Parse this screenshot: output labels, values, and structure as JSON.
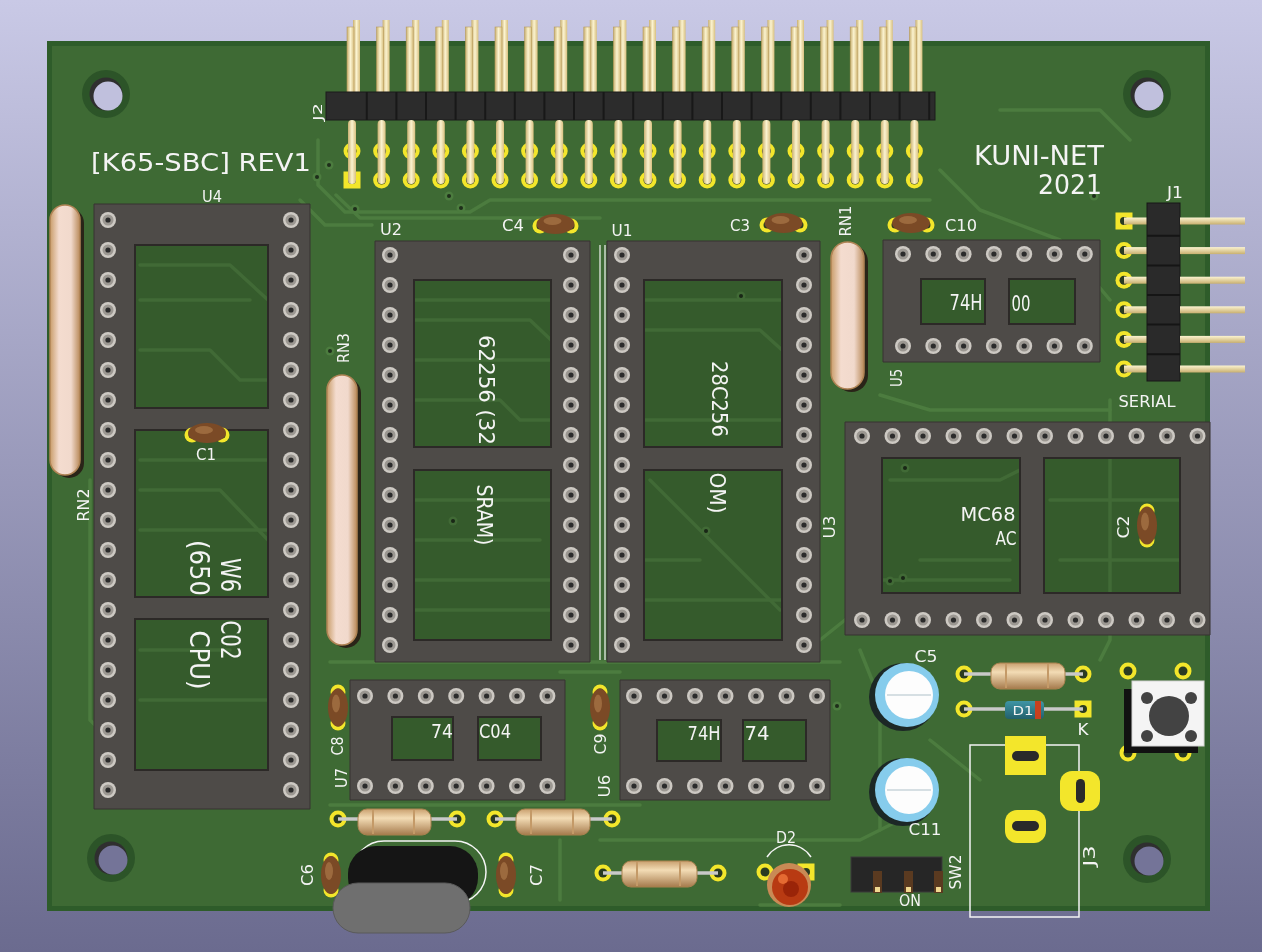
{
  "board": {
    "title": "[K65-SBC] REV1",
    "maker": "KUNI-NET",
    "year": "2021"
  },
  "components": [
    {
      "kind": "pin_header",
      "ref": "J2"
    },
    {
      "kind": "dip_socket",
      "ref": "U4",
      "marking": [
        "W6",
        "C02",
        "(650",
        "CPU)"
      ]
    },
    {
      "kind": "resistor_network",
      "ref": "RN2"
    },
    {
      "kind": "ceramic_capacitor",
      "ref": "C1"
    },
    {
      "kind": "resistor_network",
      "ref": "RN3"
    },
    {
      "kind": "dip_socket",
      "ref": "U2",
      "marking": [
        "62256 (32",
        "SRAM)"
      ]
    },
    {
      "kind": "ceramic_capacitor",
      "ref": "C4"
    },
    {
      "kind": "dip_socket",
      "ref": "U1",
      "marking": [
        "28C256",
        "OM)"
      ]
    },
    {
      "kind": "ceramic_capacitor",
      "ref": "C3"
    },
    {
      "kind": "resistor_network",
      "ref": "RN1"
    },
    {
      "kind": "ceramic_capacitor",
      "ref": "C10"
    },
    {
      "kind": "dip_socket",
      "ref": "U5",
      "marking": [
        "74H",
        "00"
      ]
    },
    {
      "kind": "right_angle_header",
      "ref": "J1",
      "label": "SERIAL"
    },
    {
      "kind": "dip_socket",
      "ref": "U3",
      "marking": [
        "MC68",
        "AC"
      ]
    },
    {
      "kind": "ceramic_capacitor",
      "ref": "C2"
    },
    {
      "kind": "ceramic_capacitor",
      "ref": "C8"
    },
    {
      "kind": "dip_socket",
      "ref": "U7",
      "marking": [
        "74",
        "C04"
      ]
    },
    {
      "kind": "ceramic_capacitor",
      "ref": "C9"
    },
    {
      "kind": "dip_socket",
      "ref": "U6",
      "marking": [
        "74H",
        "74"
      ]
    },
    {
      "kind": "electrolytic_capacitor",
      "ref": "C5"
    },
    {
      "kind": "resistor"
    },
    {
      "kind": "diode",
      "ref": "D1",
      "pin_mark": "K"
    },
    {
      "kind": "push_button"
    },
    {
      "kind": "electrolytic_capacitor",
      "ref": "C11"
    },
    {
      "kind": "dc_jack",
      "ref": "J3"
    },
    {
      "kind": "resistor"
    },
    {
      "kind": "resistor"
    },
    {
      "kind": "crystal"
    },
    {
      "kind": "ceramic_capacitor",
      "ref": "C6"
    },
    {
      "kind": "ceramic_capacitor",
      "ref": "C7"
    },
    {
      "kind": "resistor"
    },
    {
      "kind": "led",
      "ref": "D2"
    },
    {
      "kind": "slide_switch",
      "ref": "SW2",
      "label": "ON"
    }
  ]
}
